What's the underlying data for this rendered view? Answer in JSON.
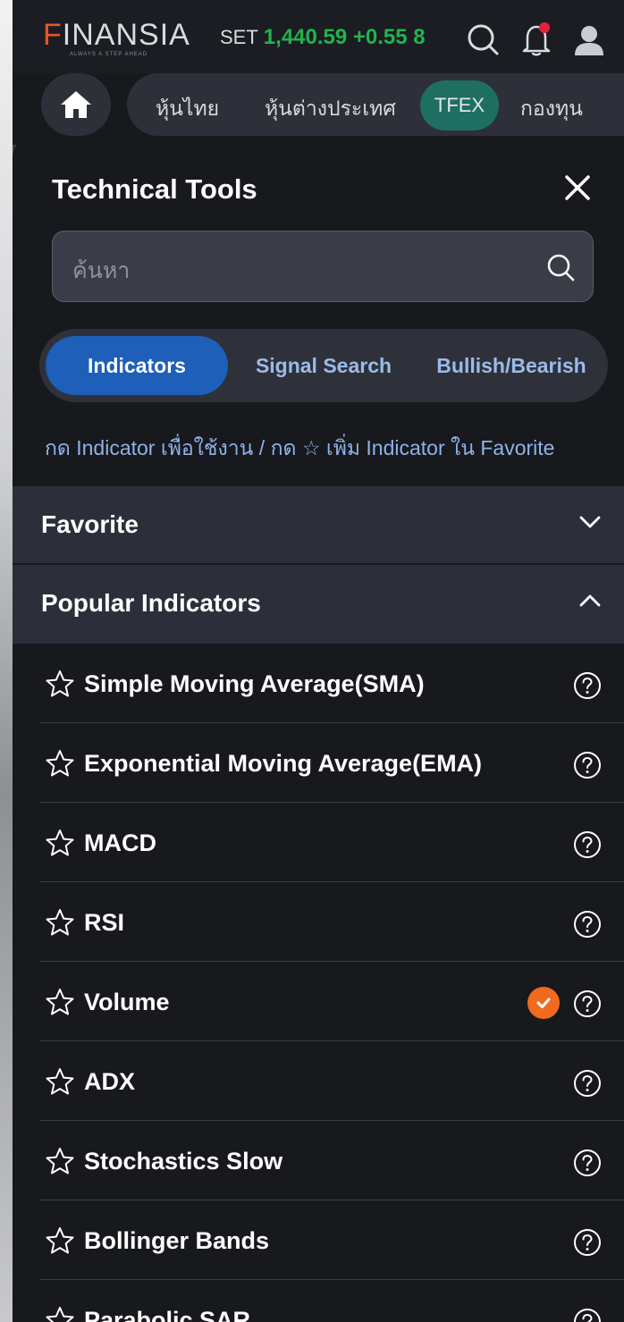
{
  "header": {
    "logo_text_first": "F",
    "logo_text_rest": "INANSIA",
    "logo_tagline": "ALWAYS A STEP AHEAD",
    "ticker_label": "SET",
    "ticker_value": "1,440.59 +0.55 8",
    "colors": {
      "brand": "#e8552b",
      "up": "#23b24e"
    }
  },
  "nav": {
    "items": [
      "หุ้นไทย",
      "หุ้นต่างประเทศ",
      "TFEX",
      "กองทุน"
    ],
    "active": "TFEX"
  },
  "panel": {
    "title": "Technical Tools",
    "search_placeholder": "ค้นหา",
    "tabs": [
      "Indicators",
      "Signal Search",
      "Bullish/Bearish"
    ],
    "active_tab": "Indicators",
    "hint": "กด Indicator เพื่อใช้งาน / กด ☆ เพิ่ม Indicator ใน Favorite",
    "sections": [
      {
        "title": "Favorite",
        "expanded": false
      },
      {
        "title": "Popular Indicators",
        "expanded": true
      }
    ],
    "indicators": [
      {
        "label": "Simple Moving Average(SMA)",
        "selected": false
      },
      {
        "label": "Exponential Moving Average(EMA)",
        "selected": false
      },
      {
        "label": "MACD",
        "selected": false
      },
      {
        "label": "RSI",
        "selected": false
      },
      {
        "label": "Volume",
        "selected": true
      },
      {
        "label": "ADX",
        "selected": false
      },
      {
        "label": "Stochastics Slow",
        "selected": false
      },
      {
        "label": "Bollinger Bands",
        "selected": false
      },
      {
        "label": "Parabolic SAR",
        "selected": false
      }
    ],
    "colors": {
      "tab_active": "#1d5fb9",
      "selected_check": "#f06a1f",
      "tfex_pill": "#1f6e62"
    }
  }
}
